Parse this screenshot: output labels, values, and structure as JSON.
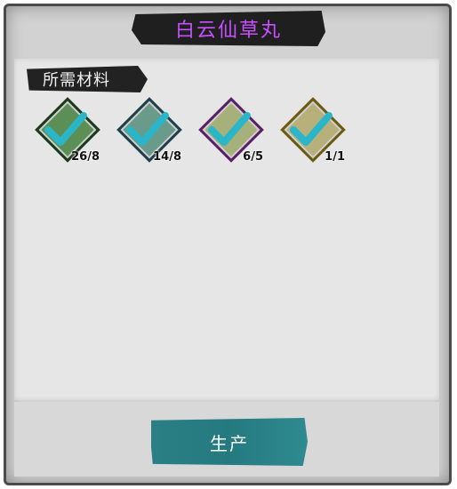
{
  "dialog": {
    "title": "白云仙草丸",
    "title_color": "#c84fff",
    "section_label": "所需材料",
    "produce_label": "生产"
  },
  "materials": [
    {
      "icon": "herb-icon",
      "frame_color": "#3b6f3a",
      "count": "26/8"
    },
    {
      "icon": "herb-icon",
      "frame_color": "#3e6d7a",
      "count": "14/8"
    },
    {
      "icon": "flower-herb-icon",
      "frame_color": "#7a3a8c",
      "count": "6/5"
    },
    {
      "icon": "flower-herb-icon",
      "frame_color": "#8a7a22",
      "count": "1/1"
    }
  ],
  "colors": {
    "check": "#2bb5c9",
    "button": "#257a80"
  }
}
